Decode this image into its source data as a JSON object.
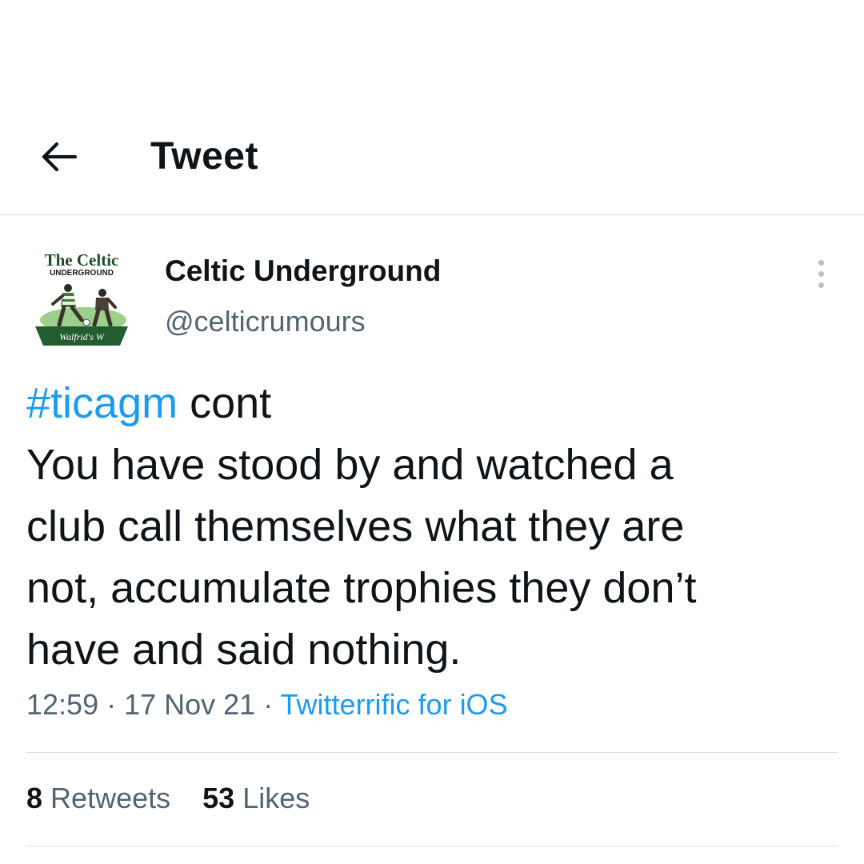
{
  "header": {
    "title": "Tweet",
    "back_icon": "arrow-left-icon"
  },
  "author": {
    "name": "Celtic Underground",
    "handle": "@celticrumours",
    "avatar": {
      "logo_top": "The Celtic",
      "logo_sub": "UNDERGROUND",
      "logo_banner": "Walfrid's W"
    }
  },
  "tweet": {
    "hashtag": "#ticagm",
    "first_line_rest": " cont",
    "lines": [
      "You have stood by and watched a",
      "club call themselves what they are",
      "not, accumulate trophies they don’t",
      "have and said nothing."
    ]
  },
  "meta": {
    "time": "12:59",
    "sep1": " · ",
    "date": "17 Nov 21",
    "sep2": " · ",
    "source": "Twitterrific for iOS"
  },
  "stats": {
    "retweets_count": "8",
    "retweets_label": "Retweets",
    "likes_count": "53",
    "likes_label": "Likes"
  },
  "colors": {
    "accent": "#1d9bf0",
    "text": "#0f1419",
    "secondary": "#536471",
    "divider": "#d9d9d9"
  }
}
